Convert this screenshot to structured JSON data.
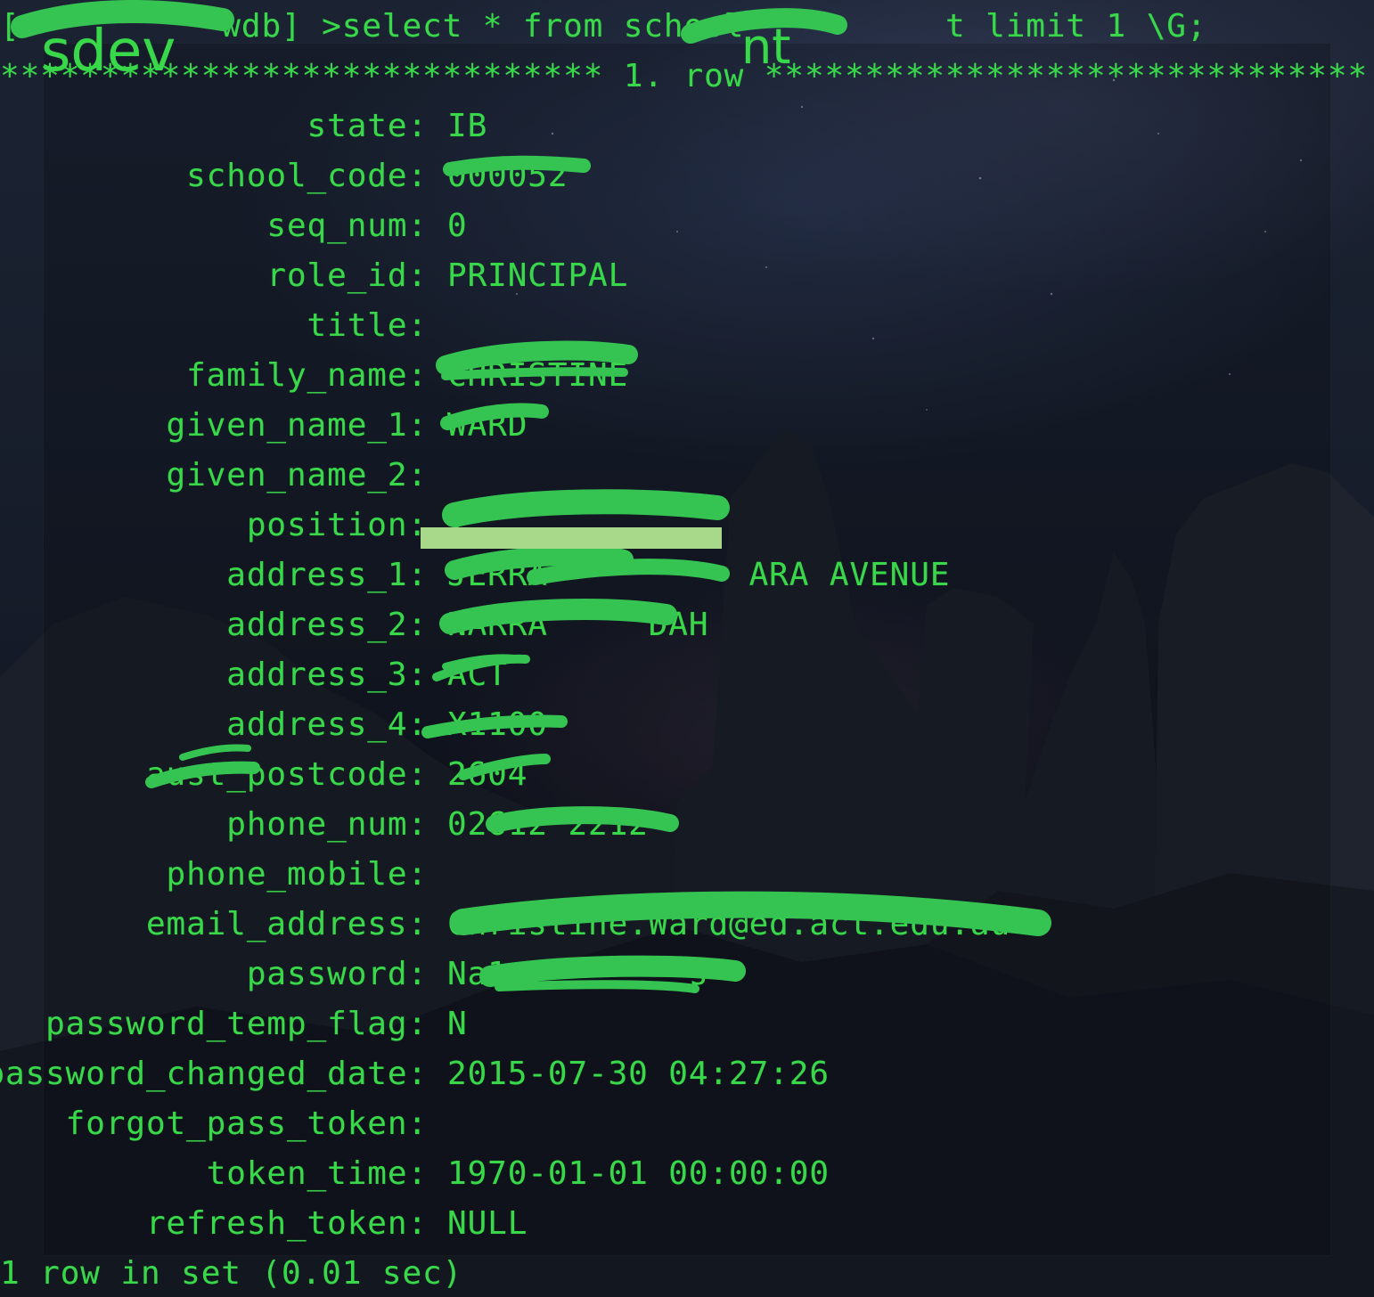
{
  "terminal": {
    "prompt": "[          wdb] >select * from school          t limit 1 \\G;",
    "row_header": "****************************** 1. row ******************************",
    "footer": "1 row in set (0.01 sec)",
    "fields": [
      {
        "label": "state:",
        "value": "IB"
      },
      {
        "label": "school_code:",
        "value": "000052"
      },
      {
        "label": "seq_num:",
        "value": "0"
      },
      {
        "label": "role_id:",
        "value": "PRINCIPAL"
      },
      {
        "label": "title:",
        "value": ""
      },
      {
        "label": "family_name:",
        "value": "CHRISTINE"
      },
      {
        "label": "given_name_1:",
        "value": "WARD"
      },
      {
        "label": "given_name_2:",
        "value": ""
      },
      {
        "label": "position:",
        "value": "I"
      },
      {
        "label": "address_1:",
        "value": "JERRA          ARA AVENUE"
      },
      {
        "label": "address_2:",
        "value": "NARRA     DAH"
      },
      {
        "label": "address_3:",
        "value": "ACT"
      },
      {
        "label": "address_4:",
        "value": "X1100"
      },
      {
        "label": "aust_postcode:",
        "value": "2604"
      },
      {
        "label": "phone_num:",
        "value": "02612 2212"
      },
      {
        "label": "phone_mobile:",
        "value": ""
      },
      {
        "label": "email_address:",
        "value": "Christine.Ward@ed.act.edu.au"
      },
      {
        "label": "password:",
        "value": "Na1         s"
      },
      {
        "label": "password_temp_flag:",
        "value": "N"
      },
      {
        "label": "password_changed_date:",
        "value": "2015-07-30 04:27:26"
      },
      {
        "label": "forgot_pass_token:",
        "value": ""
      },
      {
        "label": "token_time:",
        "value": "1970-01-01 00:00:00"
      },
      {
        "label": "refresh_token:",
        "value": "NULL"
      }
    ]
  },
  "overlay_text": {
    "left": "sdev",
    "right": "nt"
  },
  "colors": {
    "terminal_text": "#39d84a",
    "redaction_marker": "#35c452",
    "highlight_block": "#a8d98a",
    "background": "#0e1219"
  }
}
